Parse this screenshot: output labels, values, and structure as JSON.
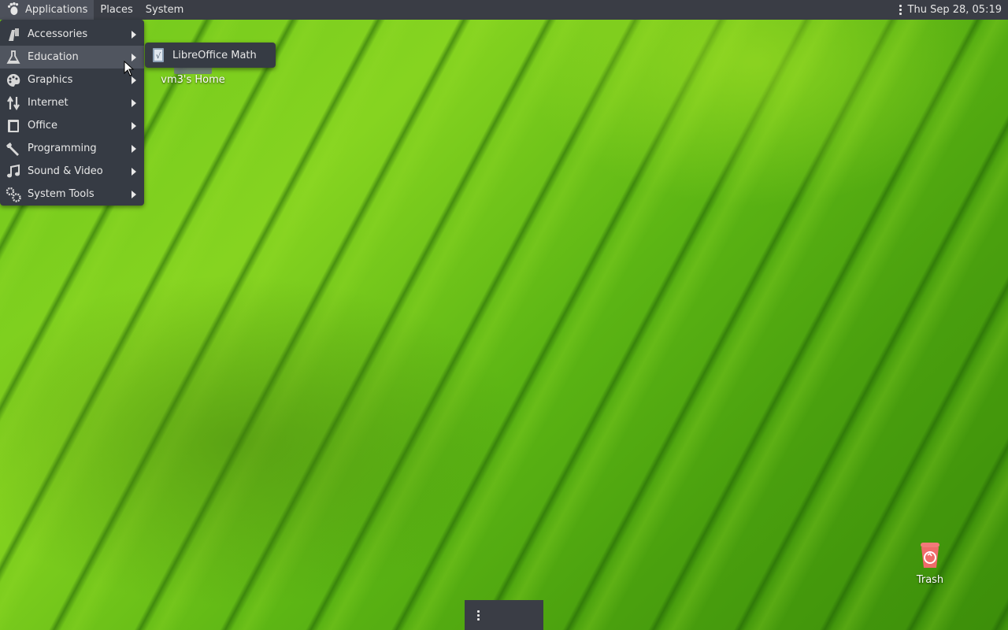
{
  "top_panel": {
    "menus": [
      {
        "label": "Applications"
      },
      {
        "label": "Places"
      },
      {
        "label": "System"
      }
    ],
    "clock": "Thu Sep 28, 05:19"
  },
  "applications_menu": {
    "items": [
      {
        "label": "Accessories",
        "icon": "accessories-icon"
      },
      {
        "label": "Education",
        "icon": "education-flask-icon"
      },
      {
        "label": "Graphics",
        "icon": "graphics-palette-icon"
      },
      {
        "label": "Internet",
        "icon": "internet-arrows-icon"
      },
      {
        "label": "Office",
        "icon": "office-document-icon"
      },
      {
        "label": "Programming",
        "icon": "programming-wrench-icon"
      },
      {
        "label": "Sound & Video",
        "icon": "music-note-icon"
      },
      {
        "label": "System Tools",
        "icon": "gears-icon"
      }
    ],
    "hovered": "Education"
  },
  "education_submenu": {
    "items": [
      {
        "label": "LibreOffice Math",
        "icon": "libreoffice-math-icon"
      }
    ]
  },
  "desktop_icons": {
    "home": {
      "label": "vm3's Home"
    },
    "trash": {
      "label": "Trash"
    }
  },
  "colors": {
    "panel": "#3a3d45",
    "menu_bg": "#363b44",
    "menu_hover": "#50555f",
    "wallpaper_green": "#6fc61c"
  }
}
